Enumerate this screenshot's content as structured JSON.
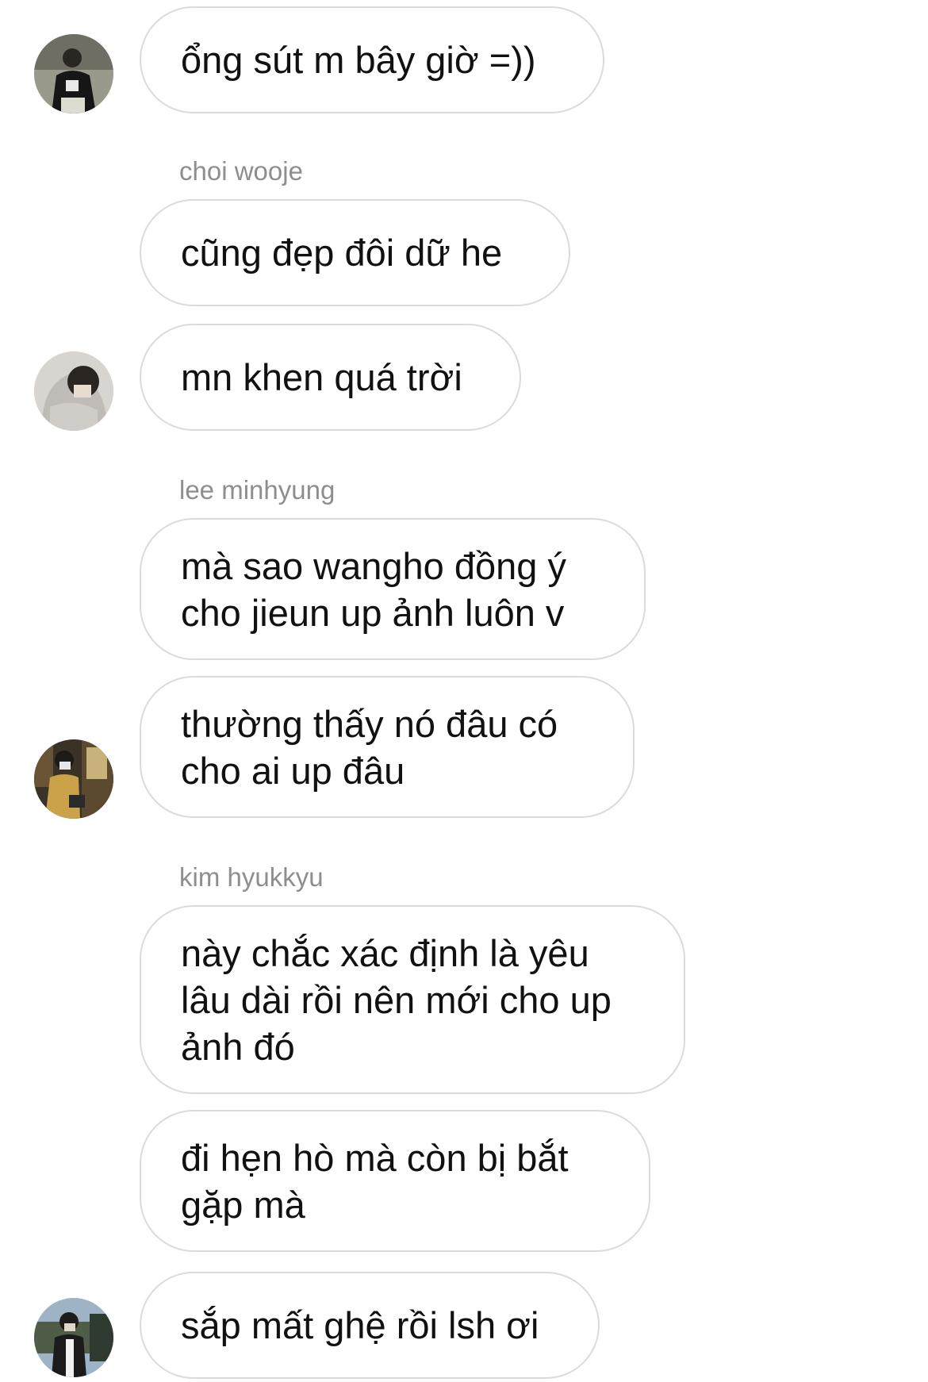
{
  "thread": {
    "messages": [
      {
        "text": "ổng sút m bây giờ =))"
      },
      {
        "sender": "choi wooje",
        "text": "cũng đẹp đôi dữ he"
      },
      {
        "text": "mn khen quá trời"
      },
      {
        "sender": "lee minhyung",
        "text": "mà sao wangho đồng ý\ncho jieun up ảnh luôn v"
      },
      {
        "text": "thường thấy nó đâu có\ncho ai up đâu"
      },
      {
        "sender": "kim hyukkyu",
        "text": "này chắc xác định là yêu\nlâu dài rồi nên mới cho up\nảnh đó"
      },
      {
        "text": "đi hẹn hò mà còn bị bắt\ngặp mà"
      },
      {
        "text": "sắp mất ghệ rồi lsh ơi"
      }
    ]
  },
  "colors": {
    "bubble_border": "#dbdbdb",
    "sender_name": "#8e8e8e",
    "text": "#111111",
    "background": "#ffffff"
  }
}
